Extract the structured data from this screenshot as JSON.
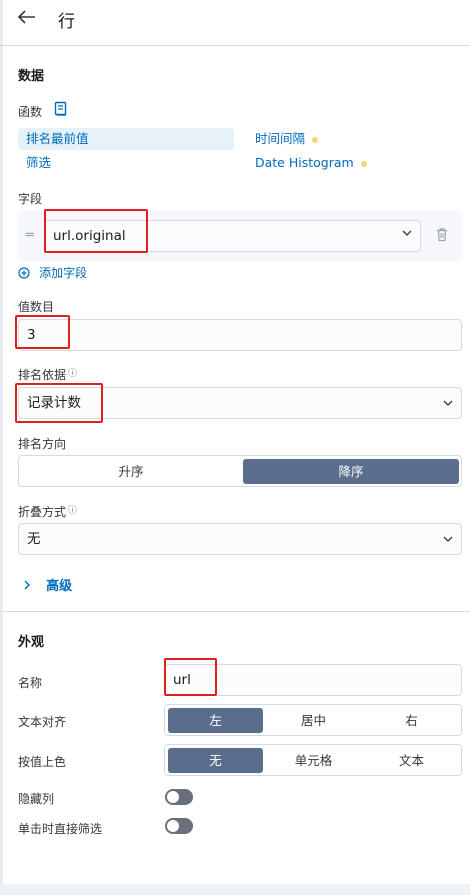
{
  "header": {
    "back_icon": "arrow-left-icon",
    "title": "行"
  },
  "data_section": {
    "title": "数据",
    "functions_label": "函数",
    "functions": [
      {
        "label": "排名最前值",
        "active": true
      },
      {
        "label": "时间间隔",
        "dot": true
      },
      {
        "label": "筛选"
      },
      {
        "label": "Date Histogram",
        "dot": true
      }
    ],
    "fields_label": "字段",
    "field_value": "url.original",
    "add_field_label": "添加字段",
    "count_label": "值数目",
    "count_value": "3",
    "rank_by_label": "排名依据",
    "rank_by_value": "记录计数",
    "direction_label": "排名方向",
    "direction_options": [
      "升序",
      "降序"
    ],
    "direction_selected": "降序",
    "collapse_label": "折叠方式",
    "collapse_value": "无",
    "advanced_label": "高级"
  },
  "appearance_section": {
    "title": "外观",
    "name_label": "名称",
    "name_value": "url",
    "text_align_label": "文本对齐",
    "text_align_options": [
      "左",
      "居中",
      "右"
    ],
    "text_align_selected": "左",
    "color_by_value_label": "按值上色",
    "color_by_value_options": [
      "无",
      "单元格",
      "文本"
    ],
    "color_by_value_selected": "无",
    "hide_column_label": "隐藏列",
    "hide_column_on": false,
    "click_filter_label": "单击时直接筛选",
    "click_filter_on": false
  },
  "colors": {
    "accent": "#006bb8",
    "segment_on": "#5a6d8c",
    "highlight": "#e0201b",
    "dot": "#f1d86f"
  }
}
